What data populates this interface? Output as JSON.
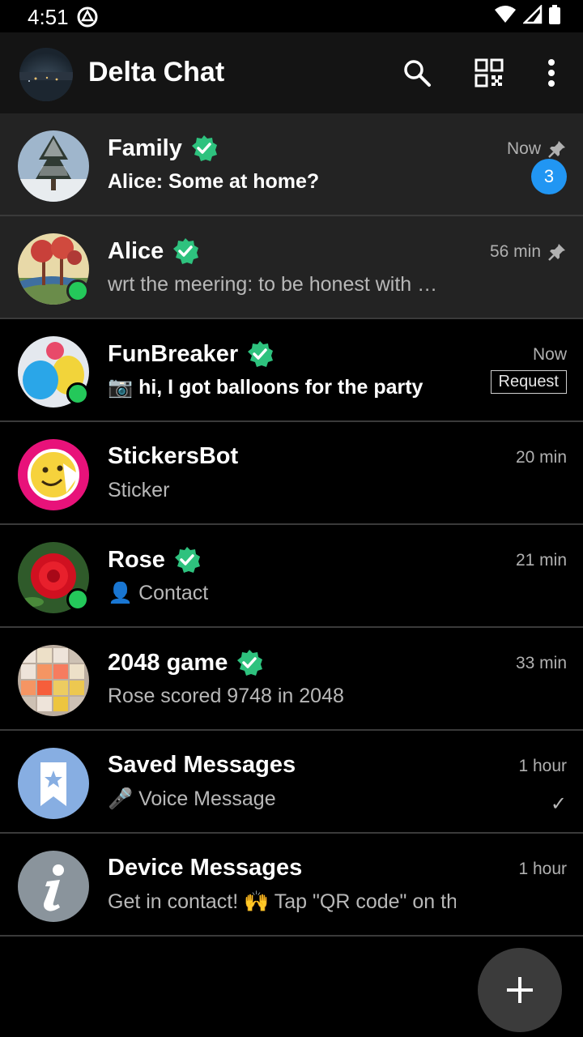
{
  "status_bar": {
    "time": "4:51",
    "icons": [
      "sync-icon",
      "wifi-icon",
      "signal-icon",
      "battery-icon"
    ]
  },
  "toolbar": {
    "title": "Delta Chat",
    "actions": [
      "search-icon",
      "qr-code-icon",
      "more-vert-icon"
    ]
  },
  "colors": {
    "background": "#000000",
    "toolbar": "#141414",
    "pinned_row": "#232323",
    "verified": "#2ec27e",
    "unread_badge": "#2196f3",
    "online": "#24c85a"
  },
  "chats": [
    {
      "name": "Family",
      "verified": true,
      "preview": "Alice: Some at home?",
      "time": "Now",
      "pinned": true,
      "unread_count": "3",
      "online": false
    },
    {
      "name": "Alice",
      "verified": true,
      "preview": "wrt the meering: to be honest with …",
      "time": "56 min",
      "pinned": true,
      "online": true
    },
    {
      "name": "FunBreaker",
      "verified": true,
      "preview": "📷 hi, I got balloons for the party",
      "time": "Now",
      "request_label": "Request",
      "online": true
    },
    {
      "name": "StickersBot",
      "verified": false,
      "preview": "Sticker",
      "time": "20 min",
      "online": false
    },
    {
      "name": "Rose",
      "verified": true,
      "preview": "👤 Contact",
      "time": "21 min",
      "online": true
    },
    {
      "name": "2048 game",
      "verified": true,
      "preview": "Rose scored 9748 in 2048",
      "time": "33 min",
      "online": false
    },
    {
      "name": "Saved Messages",
      "verified": false,
      "preview": "🎤 Voice Message",
      "time": "1 hour",
      "delivered": "✓",
      "online": false
    },
    {
      "name": "Device Messages",
      "verified": false,
      "preview": "Get in contact! 🙌 Tap \"QR code\" on th…",
      "time": "1 hour",
      "online": false
    }
  ],
  "fab": {
    "icon": "plus-icon"
  }
}
